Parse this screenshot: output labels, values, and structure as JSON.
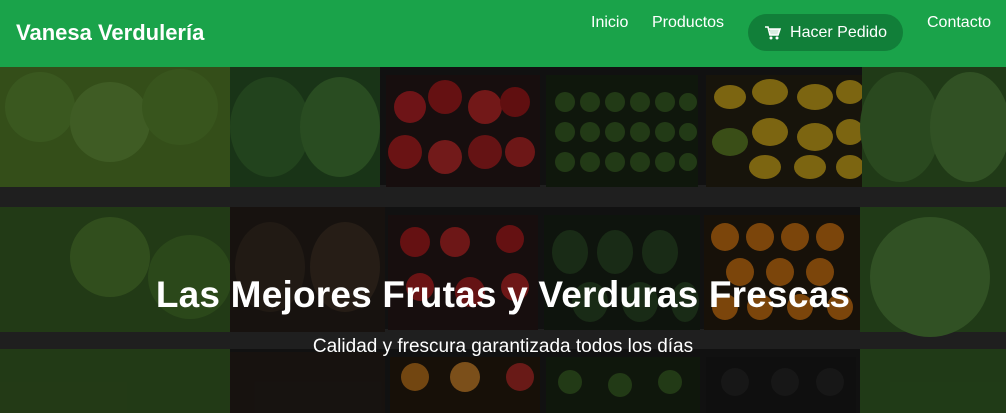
{
  "navbar": {
    "brand": "Vanesa Verdulería",
    "links": [
      {
        "label": "Inicio"
      },
      {
        "label": "Productos"
      },
      {
        "label": "Hacer Pedido",
        "icon": "cart-icon"
      },
      {
        "label": "Contacto"
      }
    ]
  },
  "hero": {
    "title": "Las Mejores Frutas y Verduras Frescas",
    "subtitle": "Calidad y frescura garantizada todos los días"
  },
  "colors": {
    "navbar_bg": "#1aa34a",
    "button_bg": "#117f39"
  }
}
